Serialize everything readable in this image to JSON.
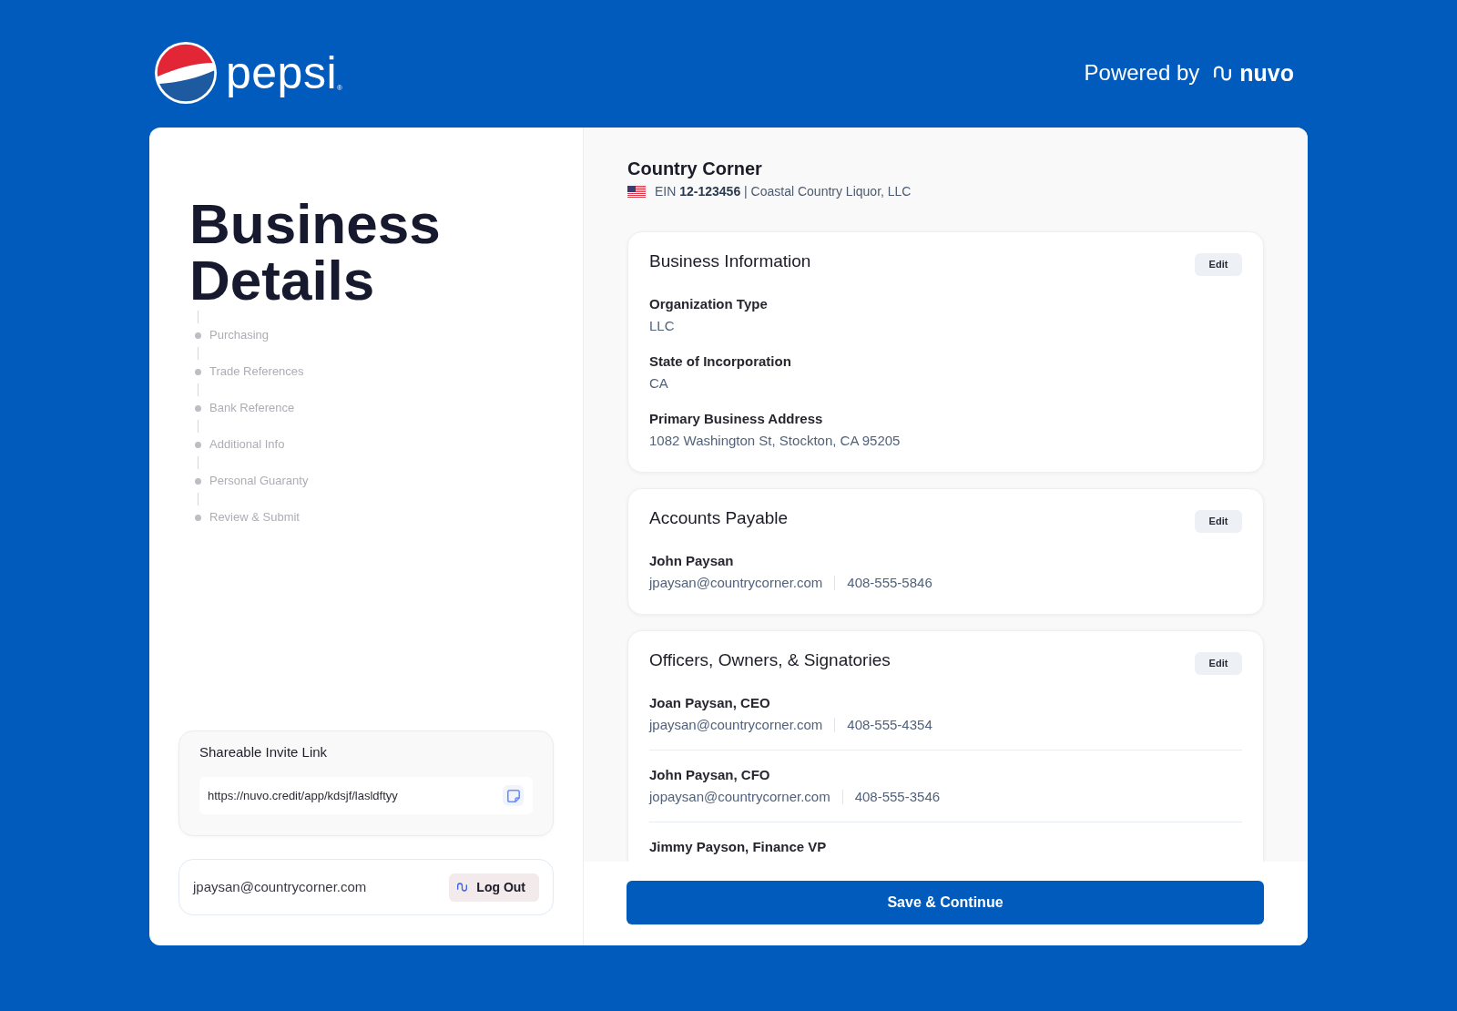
{
  "header": {
    "logo": {
      "wordmark": "pepsi",
      "trademark": "®"
    },
    "powered_by": {
      "label": "Powered by",
      "brand": "nuvo"
    }
  },
  "sidebar": {
    "title": "Business Details",
    "steps": [
      "Purchasing",
      "Trade References",
      "Bank Reference",
      "Additional Info",
      "Personal Guaranty",
      "Review & Submit"
    ],
    "invite": {
      "label": "Shareable Invite Link",
      "url": "https://nuvo.credit/app/kdsjf/lasldftyy"
    },
    "account": {
      "email": "jpaysan@countrycorner.com",
      "logout_button": "Log Out"
    }
  },
  "business": {
    "name": "Country Corner",
    "registration": "EIN **12-123456** | Coastal Country Liquor, LLC"
  },
  "sections": [
    {
      "kind": "fields",
      "title": "Business Information",
      "edit_button": "Edit",
      "fields": [
        {
          "label": "Organization Type",
          "value": "LLC"
        },
        {
          "label": "State of Incorporation",
          "value": "CA"
        },
        {
          "label": "Primary Business Address",
          "value": "1082 Washington St, Stockton, CA 95205"
        }
      ]
    },
    {
      "kind": "contacts",
      "title": "Accounts Payable",
      "edit_button": "Edit",
      "contacts": [
        {
          "name": "John Paysan",
          "email": "jpaysan@countrycorner.com",
          "phone": "408-555-5846"
        }
      ]
    },
    {
      "kind": "contacts",
      "title": "Officers, Owners, & Signatories",
      "edit_button": "Edit",
      "contacts": [
        {
          "name": "Joan Paysan, CEO",
          "email": "jpaysan@countrycorner.com",
          "phone": "408-555-4354"
        },
        {
          "name": "John Paysan, CFO",
          "email": "jopaysan@countrycorner.com",
          "phone": "408-555-3546"
        },
        {
          "name": "Jimmy Payson, Finance VP"
        }
      ]
    }
  ],
  "footer": {
    "primary_button": "Save & Continue"
  }
}
